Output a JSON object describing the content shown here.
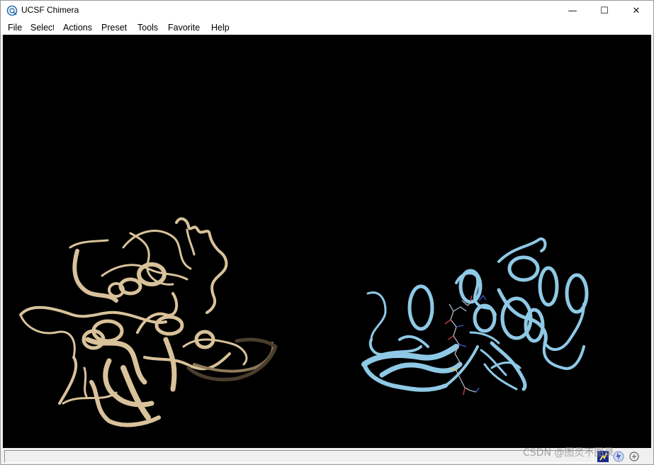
{
  "window": {
    "title": "UCSF Chimera",
    "controls": {
      "minimize": "—",
      "maximize": "☐",
      "close": "✕"
    }
  },
  "menubar": {
    "items": [
      {
        "label": "File"
      },
      {
        "label": "Select"
      },
      {
        "label": "Actions"
      },
      {
        "label": "Preset"
      },
      {
        "label": "Tools"
      },
      {
        "label": "Favorite"
      },
      {
        "label": "Help"
      }
    ]
  },
  "viewer": {
    "background": "#000000",
    "models": [
      {
        "name": "protein-model-1",
        "color": "#d9c29a"
      },
      {
        "name": "protein-model-2",
        "color": "#8ec9e6"
      }
    ]
  },
  "statusbar": {
    "message": "",
    "icons": [
      "command-line-icon",
      "lightning-icon",
      "selection-inspector-icon"
    ]
  },
  "watermark": "CSDN @图灵不图录"
}
